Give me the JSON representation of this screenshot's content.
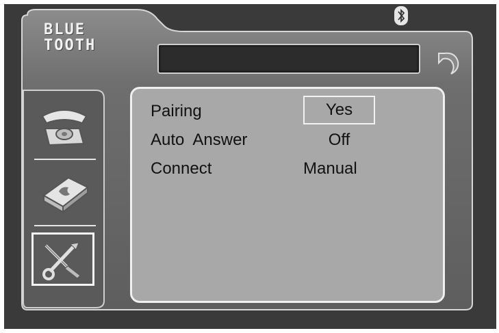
{
  "header": {
    "title_line1": "BLUE",
    "title_line2": "TOOTH",
    "status_icon": "bluetooth-icon",
    "back_icon": "back-arrow-icon"
  },
  "sidebar": {
    "items": [
      {
        "icon": "telephone-icon",
        "selected": false
      },
      {
        "icon": "phonebook-icon",
        "selected": false
      },
      {
        "icon": "tools-icon",
        "selected": true
      }
    ]
  },
  "settings": {
    "pairing": {
      "label": "Pairing",
      "value": "Yes"
    },
    "auto_answer": {
      "label": "Auto  Answer",
      "value": "Off"
    },
    "connect": {
      "label": "Connect",
      "value": "Manual"
    }
  },
  "colors": {
    "background": "#3a3a3a",
    "panel": "#6e6e6e",
    "content": "#a8a8a8",
    "highlight": "#f2f2f2"
  }
}
